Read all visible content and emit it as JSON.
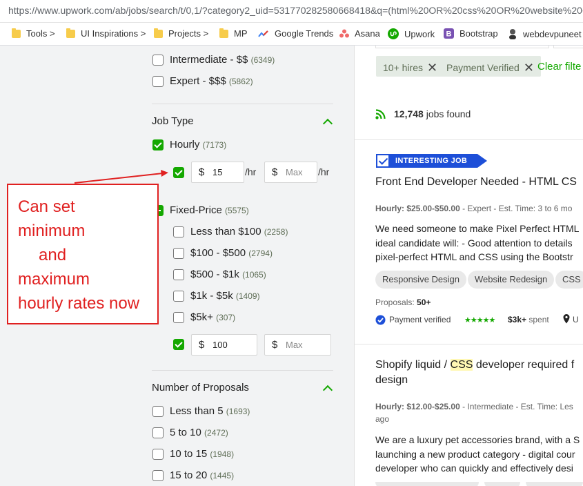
{
  "browser": {
    "url": "https://www.upwork.com/ab/jobs/search/t/0,1/?category2_uid=531770282580668418&q=(html%20OR%20css%20OR%20website%20C"
  },
  "bookmarks": [
    {
      "label": "Tools >",
      "icon": "folder-icon"
    },
    {
      "label": "UI Inspirations >",
      "icon": "folder-icon"
    },
    {
      "label": "Projects >",
      "icon": "folder-icon"
    },
    {
      "label": "MP",
      "icon": "folder-icon"
    },
    {
      "label": "Google Trends",
      "icon": "trends-icon"
    },
    {
      "label": "Asana",
      "icon": "asana-icon"
    },
    {
      "label": "Upwork",
      "icon": "upwork-icon"
    },
    {
      "label": "Bootstrap",
      "icon": "bootstrap-icon"
    },
    {
      "label": "webdevpuneet",
      "icon": "avatar-icon"
    }
  ],
  "filters": {
    "experience": [
      {
        "label": "Intermediate - $$",
        "count": "(6349)",
        "checked": false
      },
      {
        "label": "Expert - $$$",
        "count": "(5862)",
        "checked": false
      }
    ],
    "job_type": {
      "title": "Job Type",
      "hourly": {
        "label": "Hourly",
        "count": "(7173)",
        "checked": true
      },
      "hourly_min": {
        "currency": "$",
        "value": "15",
        "unit": "/hr"
      },
      "hourly_max": {
        "currency": "$",
        "placeholder": "Max",
        "unit": "/hr"
      },
      "fixed": {
        "label": "Fixed-Price",
        "count": "(5575)"
      },
      "fixed_options": [
        {
          "label": "Less than $100",
          "count": "(2258)"
        },
        {
          "label": "$100 - $500",
          "count": "(2794)"
        },
        {
          "label": "$500 - $1k",
          "count": "(1065)"
        },
        {
          "label": "$1k - $5k",
          "count": "(1409)"
        },
        {
          "label": "$5k+",
          "count": "(307)"
        }
      ],
      "fixed_min": {
        "currency": "$",
        "value": "100"
      },
      "fixed_max": {
        "currency": "$",
        "placeholder": "Max"
      }
    },
    "proposals": {
      "title": "Number of Proposals",
      "options": [
        {
          "label": "Less than 5",
          "count": "(1693)"
        },
        {
          "label": "5 to 10",
          "count": "(2472)"
        },
        {
          "label": "10 to 15",
          "count": "(1948)"
        },
        {
          "label": "15 to 20",
          "count": "(1445)"
        }
      ]
    }
  },
  "annotation": {
    "line1": "Can set",
    "line2": "minimum",
    "line3": "and",
    "line4": "maximum",
    "line5": "hourly rates now"
  },
  "results": {
    "chips": [
      "10+ hires",
      "Payment Verified"
    ],
    "clear_label": "Clear filte",
    "found_count": "12,748",
    "found_label": "jobs found",
    "jobs": [
      {
        "badge": "INTERESTING JOB",
        "title": "Front End Developer Needed - HTML CS",
        "meta_rate": "Hourly: $25.00-$50.00",
        "meta_rest": " - Expert - Est. Time: 3 to 6 mo",
        "desc": [
          "We need someone to make Pixel Perfect HTML",
          "ideal candidate will: - Good attention to details",
          "pixel-perfect HTML and CSS using the Bootstr"
        ],
        "skills": [
          "Responsive Design",
          "Website Redesign",
          "CSS"
        ],
        "proposals_label": "Proposals:",
        "proposals_value": "50+",
        "payment": "Payment verified",
        "stars": "★★★★★",
        "spent_value": "$3k+",
        "spent_label": "spent",
        "location": "U"
      },
      {
        "title_pre": "Shopify liquid / ",
        "title_hl": "CSS",
        "title_post": " developer required f",
        "title_line2": "design",
        "meta_rate": "Hourly: $12.00-$25.00",
        "meta_rest": " - Intermediate - Est. Time: Les",
        "meta_line2": "ago",
        "desc": [
          "We are a luxury pet accessories brand, with a S",
          "launching a new product category - digital cour",
          "developer who can quickly and effectively desi"
        ]
      }
    ]
  },
  "colors": {
    "accent": "#14a800",
    "annotation": "#e02020",
    "badge": "#1d4fd8"
  }
}
